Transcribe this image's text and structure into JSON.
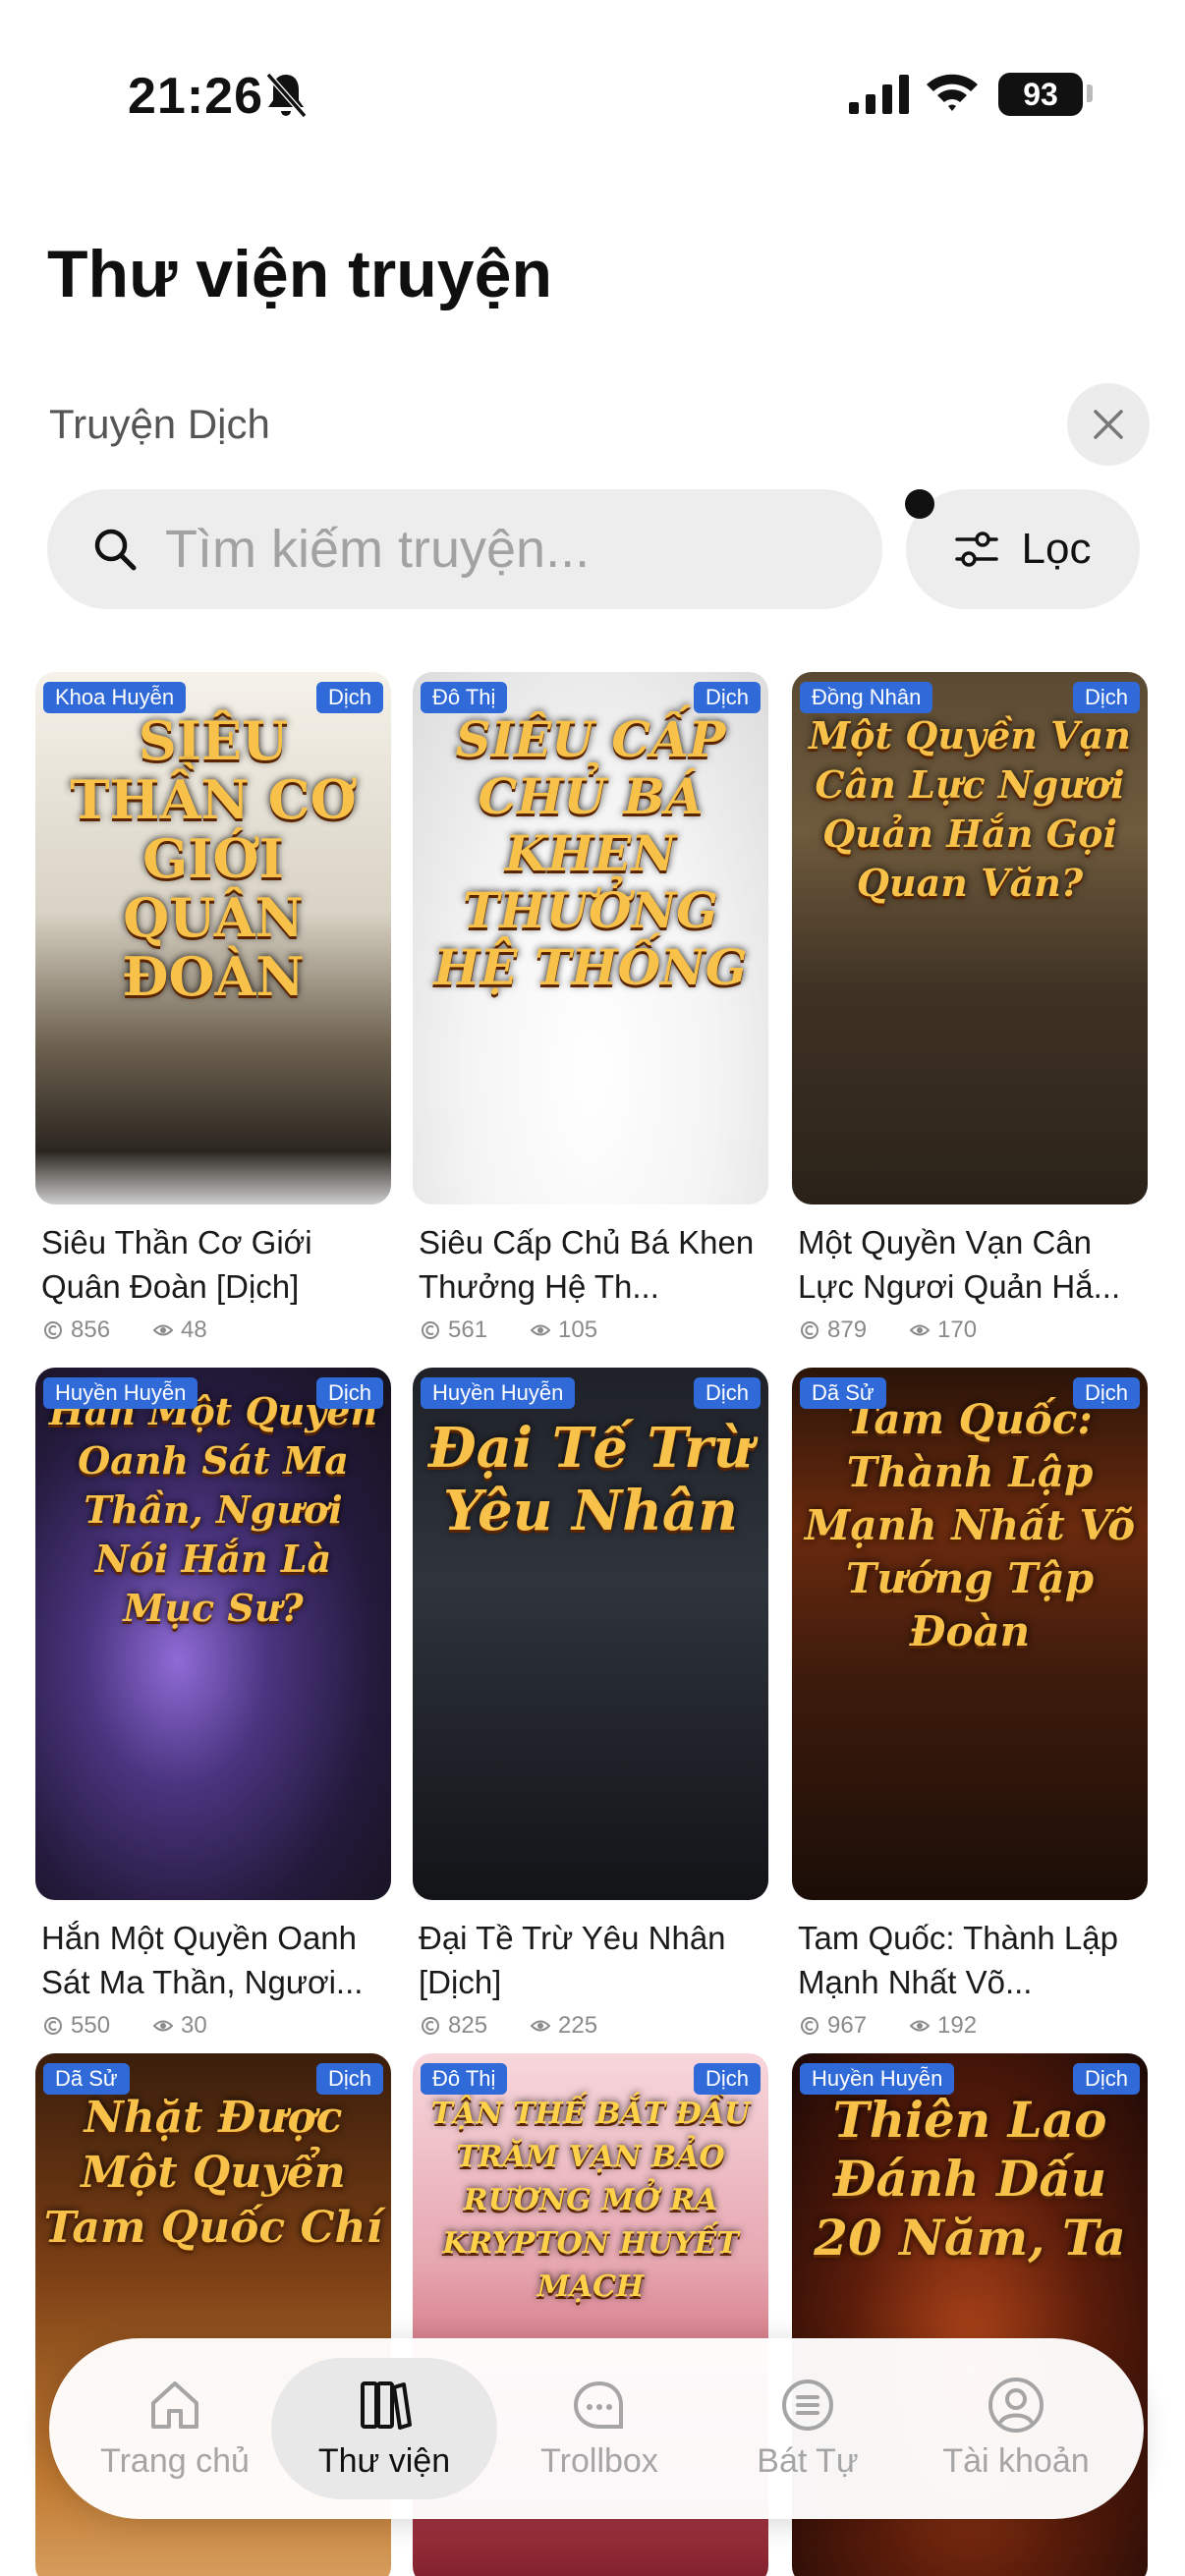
{
  "status": {
    "time": "21:26",
    "battery": "93"
  },
  "header": {
    "title": "Thư viện truyện",
    "subtitle": "Truyện Dịch"
  },
  "search": {
    "placeholder": "Tìm kiếm truyện..."
  },
  "filter": {
    "label": "Lọc"
  },
  "books": [
    {
      "genre": "Khoa Huyễn",
      "tag": "Dịch",
      "cover_text": "SIÊU THẦN CƠ GIỚI QUÂN ĐOÀN",
      "title": "Siêu Thần Cơ Giới Quân Đoàn [Dịch]",
      "chapters": "856",
      "views": "48"
    },
    {
      "genre": "Đô Thị",
      "tag": "Dịch",
      "cover_text": "SIÊU CẤP CHỦ BÁ KHEN THƯỞNG HỆ THỐNG",
      "title": "Siêu Cấp Chủ Bá Khen Thưởng Hệ Th...",
      "chapters": "561",
      "views": "105"
    },
    {
      "genre": "Đồng Nhân",
      "tag": "Dịch",
      "cover_text": "Một Quyền Vạn Cân Lực Ngươi Quản Hắn Gọi Quan Văn?",
      "title": "Một Quyền Vạn Cân Lực Ngươi Quản Hắ...",
      "chapters": "879",
      "views": "170"
    },
    {
      "genre": "Huyền Huyễn",
      "tag": "Dịch",
      "cover_text": "Hắn Một Quyền Oanh Sát Ma Thần, Ngươi Nói Hắn Là Mục Sư?",
      "title": "Hắn Một Quyền Oanh Sát Ma Thần, Ngươi...",
      "chapters": "550",
      "views": "30"
    },
    {
      "genre": "Huyền Huyễn",
      "tag": "Dịch",
      "cover_text": "Đại Tế Trừ Yêu Nhân",
      "title": "Đại Tề Trừ Yêu Nhân [Dịch]",
      "chapters": "825",
      "views": "225"
    },
    {
      "genre": "Dã Sử",
      "tag": "Dịch",
      "cover_text": "Tam Quốc: Thành Lập Mạnh Nhất Võ Tướng Tập Đoàn",
      "title": "Tam Quốc: Thành Lập Mạnh Nhất Võ...",
      "chapters": "967",
      "views": "192"
    },
    {
      "genre": "Dã Sử",
      "tag": "Dịch",
      "cover_text": "Nhặt Được Một Quyển Tam Quốc Chí"
    },
    {
      "genre": "Đô Thị",
      "tag": "Dịch",
      "cover_text": "TẬN THẾ BẮT ĐẦU TRĂM VẠN BẢO RƯƠNG MỞ RA KRYPTON HUYẾT MẠCH"
    },
    {
      "genre": "Huyền Huyễn",
      "tag": "Dịch",
      "cover_text": "Thiên Lao Đánh Dấu 20 Năm, Ta"
    }
  ],
  "tabs": [
    {
      "label": "Trang chủ",
      "icon": "home-icon"
    },
    {
      "label": "Thư viện",
      "icon": "books-icon"
    },
    {
      "label": "Trollbox",
      "icon": "chat-bubble-icon"
    },
    {
      "label": "Bát Tự",
      "icon": "list-circle-icon"
    },
    {
      "label": "Tài khoản",
      "icon": "person-icon"
    }
  ],
  "colors": {
    "tag_blue": "#2f6ad8",
    "cover_gold": "#f7c14a"
  }
}
